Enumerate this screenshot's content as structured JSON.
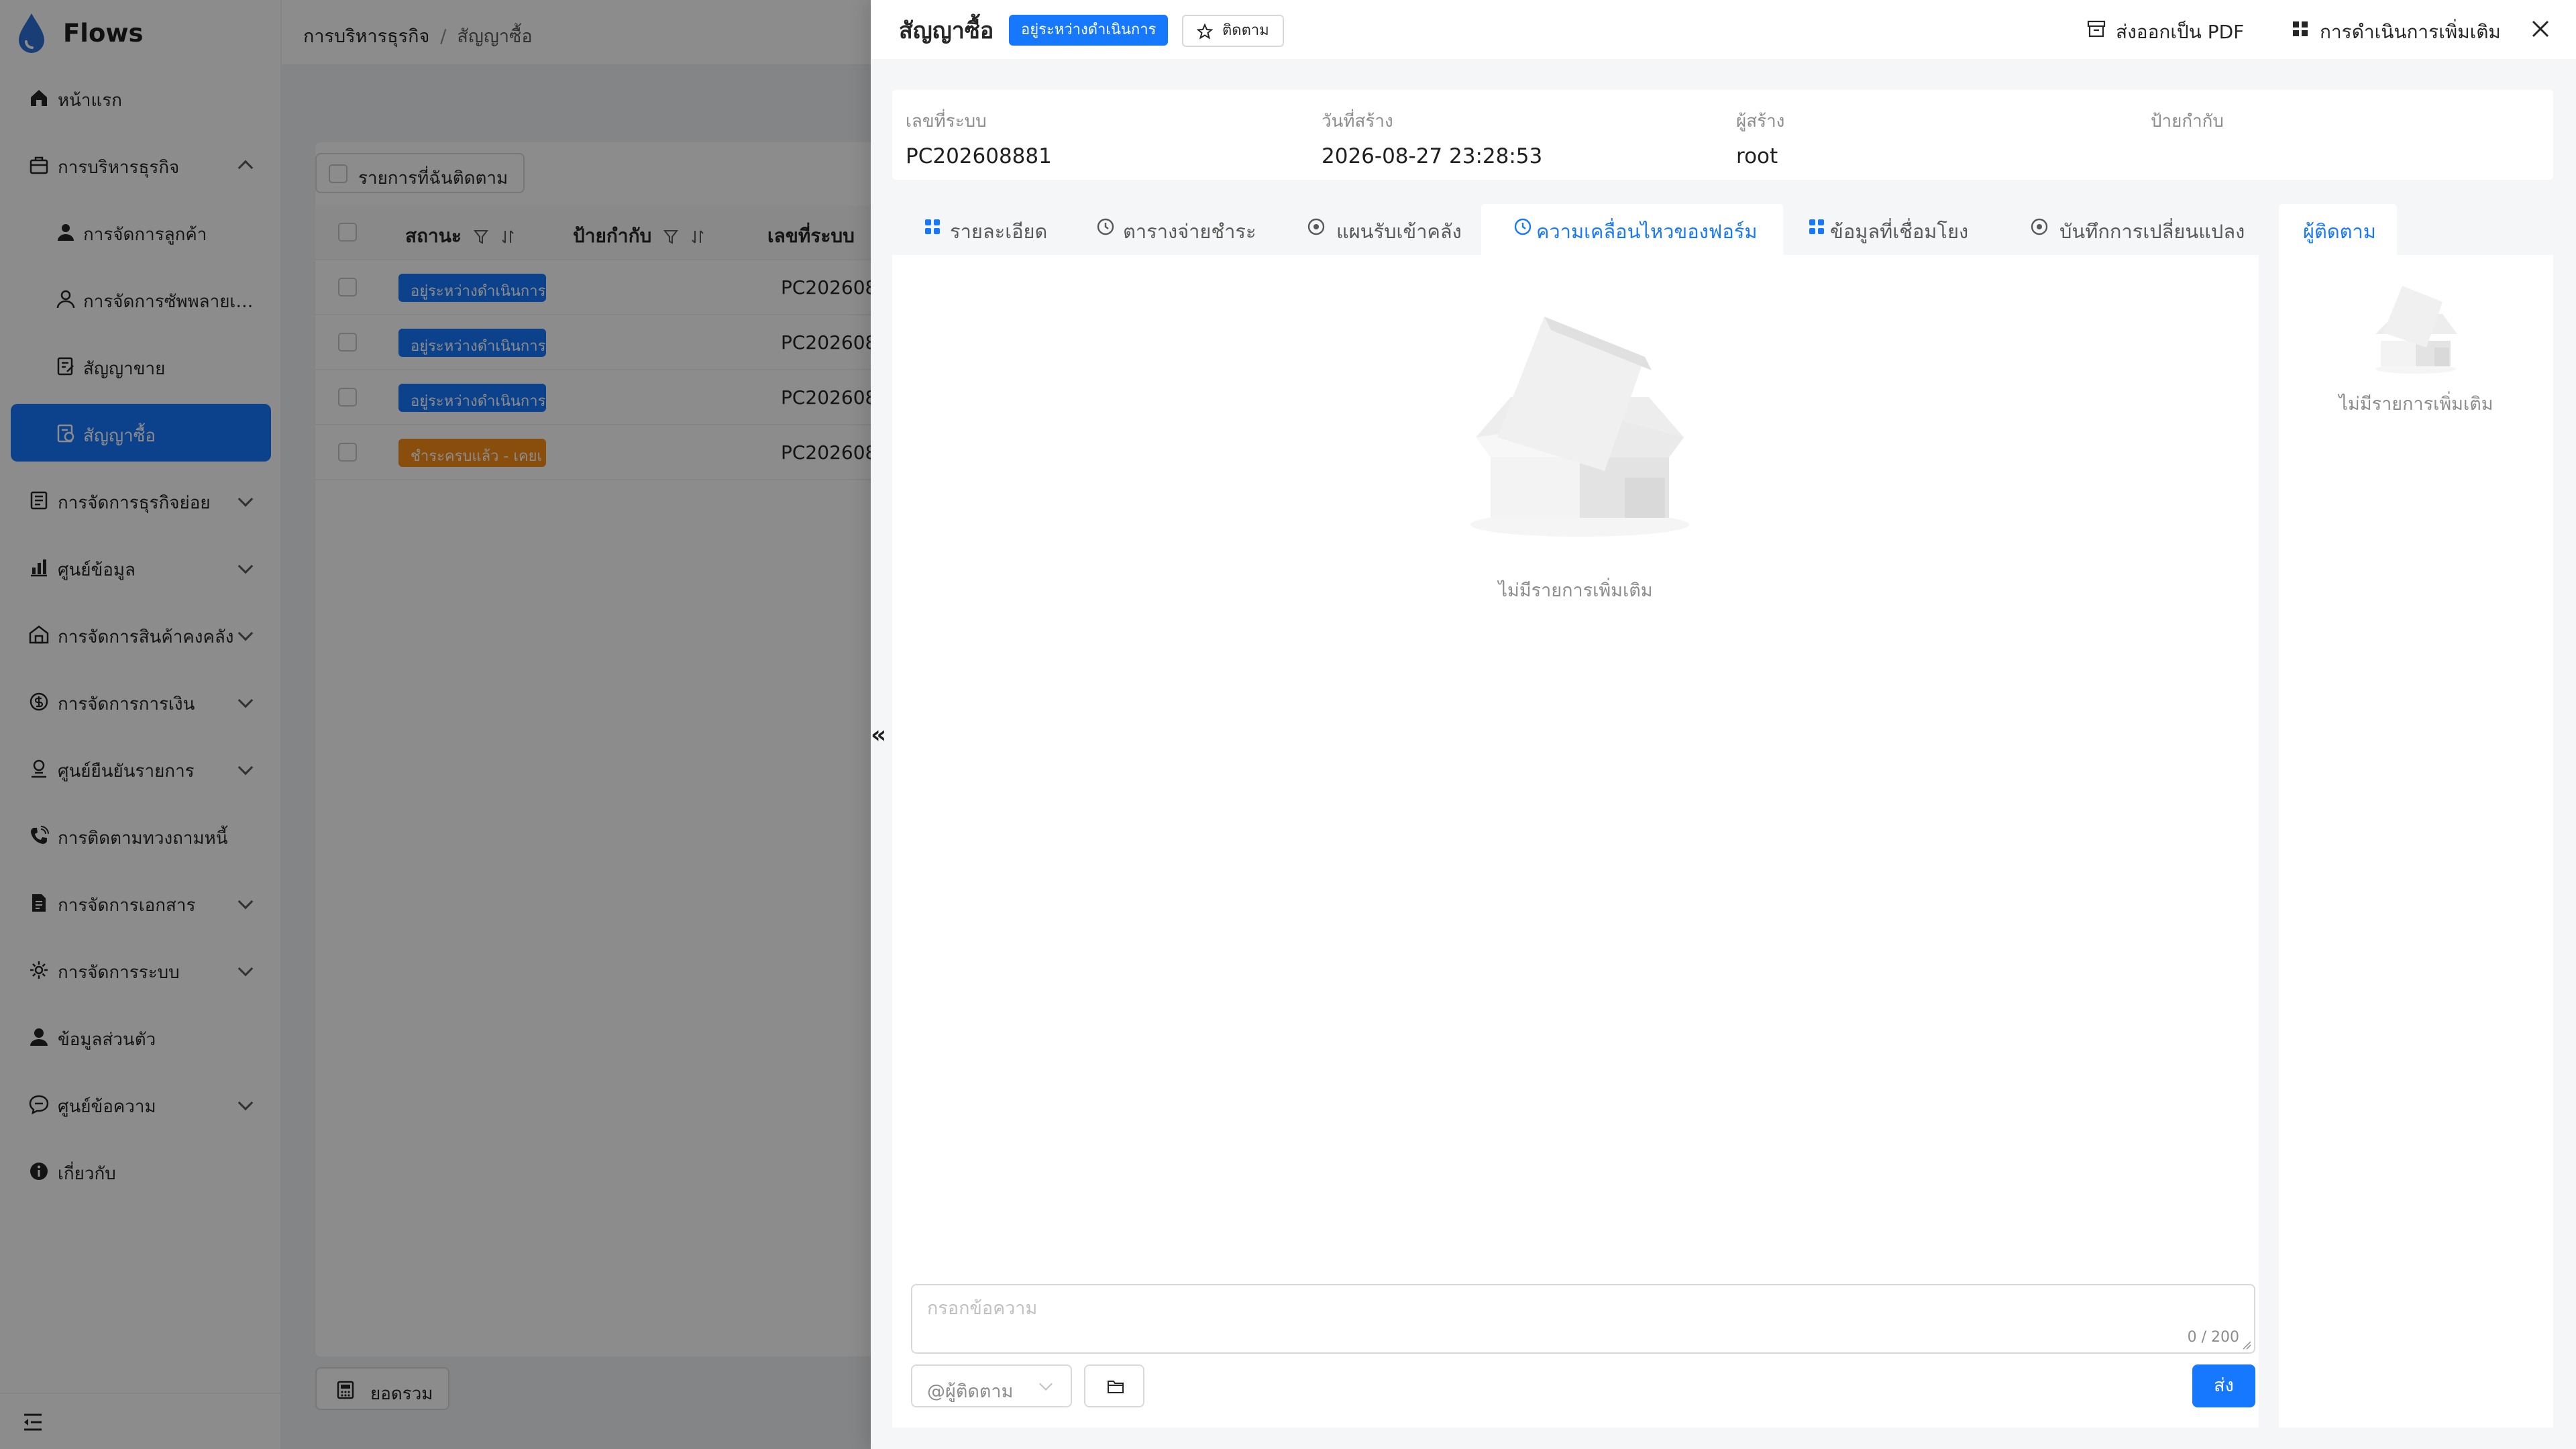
{
  "app": {
    "name": "Flows",
    "brand_color": "#1677ff"
  },
  "sidebar": {
    "items": [
      {
        "label": "หน้าแรก",
        "icon": "home-icon"
      },
      {
        "label": "การบริหารธุรกิจ",
        "icon": "briefcase-icon",
        "expanded": true
      },
      {
        "label": "การจัดการลูกค้า",
        "icon": "user-icon"
      },
      {
        "label": "การจัดการซัพพลายเออร์",
        "icon": "user-outline-icon"
      },
      {
        "label": "สัญญาขาย",
        "icon": "contract-icon"
      },
      {
        "label": "สัญญาซื้อ",
        "icon": "purchase-icon",
        "active": true
      },
      {
        "label": "การจัดการธุรกิจย่อย",
        "icon": "building-icon"
      },
      {
        "label": "ศูนย์ข้อมูล",
        "icon": "chart-icon"
      },
      {
        "label": "การจัดการสินค้าคงคลัง",
        "icon": "warehouse-icon"
      },
      {
        "label": "การจัดการการเงิน",
        "icon": "money-icon"
      },
      {
        "label": "ศูนย์ยืนยันรายการ",
        "icon": "verify-icon"
      },
      {
        "label": "การติดตามทวงถามหนี้",
        "icon": "phone-icon"
      },
      {
        "label": "การจัดการเอกสาร",
        "icon": "document-icon"
      },
      {
        "label": "การจัดการระบบ",
        "icon": "gear-icon"
      },
      {
        "label": "ข้อมูลส่วนตัว",
        "icon": "profile-icon"
      },
      {
        "label": "ศูนย์ข้อความ",
        "icon": "message-icon"
      },
      {
        "label": "เกี่ยวกับ",
        "icon": "info-icon"
      }
    ]
  },
  "breadcrumb": {
    "parent": "การบริหารธุรกิจ",
    "separator": "/",
    "current": "สัญญาซื้อ"
  },
  "list": {
    "favorite_toggle": "รายการที่ฉันติดตาม",
    "columns": {
      "status": "สถานะ",
      "tag": "ป้ายกำกับ",
      "number": "เลขที่ระบบ"
    },
    "rows": [
      {
        "status": "อยู่ระหว่างดำเนินการ",
        "status_color": "#1677ff",
        "number": "PC202608"
      },
      {
        "status": "อยู่ระหว่างดำเนินการ",
        "status_color": "#1677ff",
        "number": "PC202608"
      },
      {
        "status": "อยู่ระหว่างดำเนินการ",
        "status_color": "#1677ff",
        "number": "PC202608"
      },
      {
        "status": "ชำระครบแล้ว - เคยเ",
        "status_color": "#fa8c16",
        "number": "PC202608"
      }
    ],
    "summary_button": "ยอดรวม"
  },
  "drawer": {
    "title": "สัญญาซื้อ",
    "status": "อยู่ระหว่างดำเนินการ",
    "follow": "ติดตาม",
    "export_pdf": "ส่งออกเป็น PDF",
    "more_actions": "การดำเนินการเพิ่มเติม",
    "info": {
      "system_no_label": "เลขที่ระบบ",
      "system_no": "PC202608881",
      "created_label": "วันที่สร้าง",
      "created": "2026-08-27 23:28:53",
      "creator_label": "ผู้สร้าง",
      "creator": "root",
      "tag_label": "ป้ายกำกับ",
      "tag": ""
    },
    "tabs": [
      {
        "label": "รายละเอียด",
        "icon": "grid-icon"
      },
      {
        "label": "ตารางจ่ายชำระ",
        "icon": "clock-icon"
      },
      {
        "label": "แผนรับเข้าคลัง",
        "icon": "circle-icon"
      },
      {
        "label": "ความเคลื่อนไหวของฟอร์ม",
        "icon": "clock-icon",
        "active": true
      },
      {
        "label": "ข้อมูลที่เชื่อมโยง",
        "icon": "grid-icon"
      },
      {
        "label": "บันทึกการเปลี่ยนแปลง",
        "icon": "circle-icon"
      }
    ],
    "empty_text": "ไม่มีรายการเพิ่มเติม",
    "message": {
      "placeholder": "กรอกข้อความ",
      "count": "0 / 200",
      "mention": "@ผู้ติดตาม",
      "send": "ส่ง"
    },
    "followers": {
      "tab": "ผู้ติดตาม",
      "empty_text": "ไม่มีรายการเพิ่มเติม"
    }
  }
}
